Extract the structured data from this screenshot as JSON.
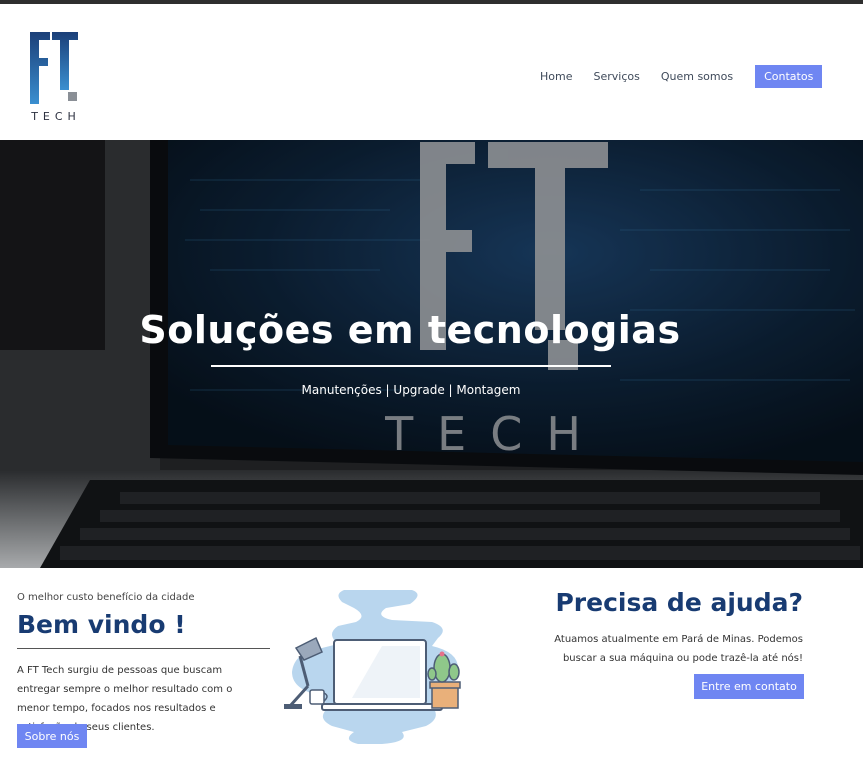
{
  "header": {
    "logo": {
      "mark": "FT",
      "word": "TECH"
    },
    "nav": [
      {
        "label": "Home"
      },
      {
        "label": "Serviços"
      },
      {
        "label": "Quem somos"
      },
      {
        "label": "Contatos"
      }
    ]
  },
  "hero": {
    "title": "Soluções em tecnologias",
    "subtitle": "Manutenções | Upgrade | Montagem"
  },
  "welcome": {
    "kicker": "O melhor custo benefício da cidade",
    "title": "Bem vindo !",
    "text": "A FT Tech surgiu de pessoas que buscam entregar sempre o melhor resultado com o menor tempo, focados nos resultados e satisfação de seus clientes.",
    "button": "Sobre nós"
  },
  "help": {
    "title": "Precisa de ajuda?",
    "text": "Atuamos atualmente em Pará de Minas. Podemos buscar a sua máquina ou pode trazê-la até nós!",
    "button": "Entre em contato"
  },
  "colors": {
    "accent": "#6f86f2",
    "heading": "#183b72"
  }
}
